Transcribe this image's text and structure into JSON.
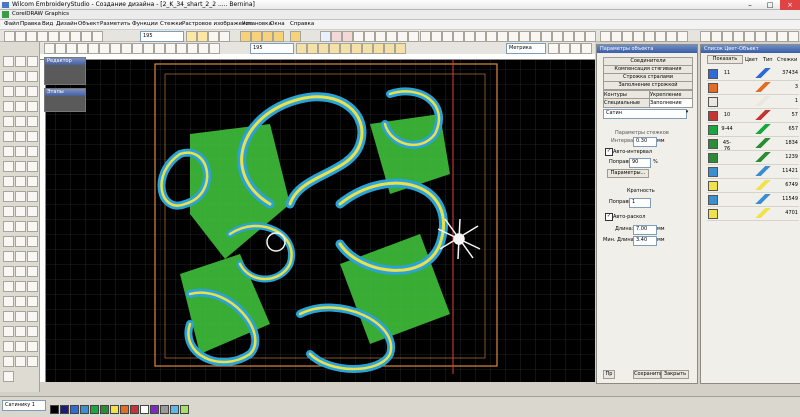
{
  "window": {
    "title": "Wilcom EmbroideryStudio - Создание дизайна - [2_K_34_shart_2_2 ..... Bernina]"
  },
  "coreldraw_bar": {
    "label": "CorelDRAW Graphics"
  },
  "menu": [
    "Файл",
    "Правка",
    "Вид",
    "Дизайн",
    "Объект",
    "Разметить",
    "Функции",
    "Стежки",
    "Растровое изображение",
    "Установка",
    "Окна",
    "Справка"
  ],
  "toolbar": {
    "zoom_value": "195",
    "zoom_value2": "195",
    "units": "Метрика"
  },
  "float_panels": {
    "editor": "Редактор",
    "stages": "Этапы"
  },
  "props": {
    "title": "Параметры объекта",
    "buttons": [
      "Соединители",
      "Компенсация стягивания",
      "Строжка стралами",
      "Заполнение строжкой"
    ],
    "tabs_row1": [
      "Контуры",
      "Укрепление"
    ],
    "tabs_row2": [
      "Специальные",
      "Заполнение"
    ],
    "stitch_type": "Сатин",
    "section_strokes": "Параметры стежков",
    "interval_label": "Интервал:",
    "interval_value": "0.30",
    "interval_unit": "мм",
    "auto_interval": "Авто-интервал",
    "correction_label": "Поправка",
    "correction_value": "90",
    "percent": "%",
    "params_button": "Параметры...",
    "section_multiplicity": "Кратность",
    "correction2_label": "Поправка",
    "correction2_value": "1",
    "auto_split": "Авто-раскол",
    "length_label": "Длина:",
    "length_value": "7.00",
    "length_unit": "мм",
    "minlength_label": "Мин. Длина:",
    "minlength_value": "3.40",
    "minlength_unit": "мм",
    "footer_button1": "Пр",
    "footer_button2": "Сохранить",
    "footer_button3": "Закрыть"
  },
  "seqlist": {
    "title": "Список Цвет-Объект",
    "show_button": "Показать",
    "cols": [
      "Цвет",
      "Тип",
      "Стежки"
    ],
    "rows": [
      {
        "num": "11",
        "color": "#2f6bd8",
        "count": "37434"
      },
      {
        "num": "",
        "color": "#e36d26",
        "count": "3"
      },
      {
        "num": "",
        "color": "#e9e7df",
        "count": "1"
      },
      {
        "num": "10",
        "color": "#c73434",
        "count": "57"
      },
      {
        "num": "9-44",
        "color": "#19a83f",
        "count": "657"
      },
      {
        "num": "45-76",
        "color": "#2a8d35",
        "count": "1834"
      },
      {
        "num": "",
        "color": "#2a8d35",
        "count": "1239"
      },
      {
        "num": "",
        "color": "#3b8fd0",
        "count": "11421"
      },
      {
        "num": "",
        "color": "#f2e24a",
        "count": "6749"
      },
      {
        "num": "",
        "color": "#3b8fd0",
        "count": "11549"
      },
      {
        "num": "",
        "color": "#f2e24a",
        "count": "4701"
      }
    ]
  },
  "status": {
    "field_left": "Сатинику 1"
  },
  "colors": {
    "palette": [
      "#000000",
      "#1c1c7a",
      "#2f6bd8",
      "#3b8fd0",
      "#19a83f",
      "#2a8d35",
      "#f2e24a",
      "#e36d26",
      "#c73434",
      "#ffffff",
      "#7b2bbf",
      "#9a9a9a",
      "#5fb8e8",
      "#a4e06a"
    ]
  }
}
